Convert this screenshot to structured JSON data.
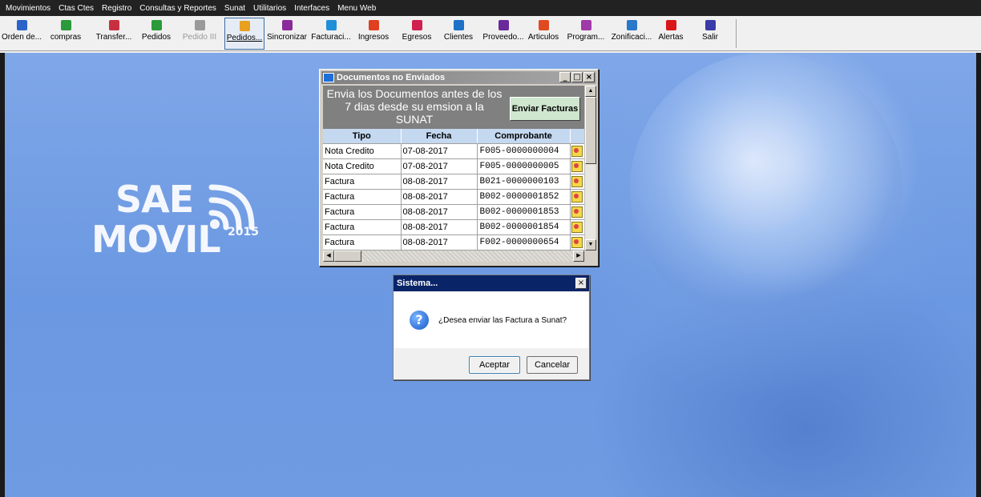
{
  "menu": [
    "Movimientos",
    "Ctas Ctes",
    "Registro",
    "Consultas y Reportes",
    "Sunat",
    "Utilitarios",
    "Interfaces",
    "Menu Web"
  ],
  "toolbar": [
    {
      "label": "Orden de...",
      "icon": "order-icon",
      "color": "#2a64c8",
      "state": "normal"
    },
    {
      "label": "compras",
      "icon": "purchases-icon",
      "color": "#2a9a3a",
      "state": "normal"
    },
    {
      "label": "Transfer...",
      "icon": "transfer-icon",
      "color": "#c83040",
      "state": "normal"
    },
    {
      "label": "Pedidos",
      "icon": "orders-icon",
      "color": "#2a9a3a",
      "state": "normal"
    },
    {
      "label": "Pedido III",
      "icon": "order-3-icon",
      "color": "#9a9a9a",
      "state": "disabled"
    },
    {
      "label": "Pedidos...",
      "icon": "orders-list-icon",
      "color": "#e8a020",
      "state": "pressed"
    },
    {
      "label": "Sincronizar",
      "icon": "sync-icon",
      "color": "#8a2a9a",
      "state": "normal"
    },
    {
      "label": "Facturaci...",
      "icon": "invoice-icon",
      "color": "#1e90d8",
      "state": "normal"
    },
    {
      "label": "Ingresos",
      "icon": "income-icon",
      "color": "#e04020",
      "state": "normal"
    },
    {
      "label": "Egresos",
      "icon": "expenses-icon",
      "color": "#d02050",
      "state": "normal"
    },
    {
      "label": "Clientes",
      "icon": "clients-icon",
      "color": "#1e70c8",
      "state": "normal"
    },
    {
      "label": "Proveedo...",
      "icon": "suppliers-icon",
      "color": "#6a2a9a",
      "state": "normal"
    },
    {
      "label": "Articulos",
      "icon": "articles-icon",
      "color": "#e04a20",
      "state": "normal"
    },
    {
      "label": "Program...",
      "icon": "program-icon",
      "color": "#a03aa8",
      "state": "normal"
    },
    {
      "label": "Zonificaci...",
      "icon": "zone-icon",
      "color": "#2a78c8",
      "state": "normal"
    },
    {
      "label": "Alertas",
      "icon": "alert-icon",
      "color": "#d81818",
      "state": "normal"
    },
    {
      "label": "Salir",
      "icon": "exit-icon",
      "color": "#3a3aa8",
      "state": "normal"
    }
  ],
  "logo": {
    "line1": "SAE",
    "line2": "MOVIL",
    "year": "2015"
  },
  "window": {
    "title": "Documentos no Enviados",
    "message": "Envia los Documentos antes de los 7 dias desde su emsion a la SUNAT",
    "send_button": "Enviar Facturas",
    "columns": [
      "Tipo",
      "Fecha",
      "Comprobante"
    ],
    "rows": [
      {
        "tipo": "Nota Credito",
        "fecha": "07-08-2017",
        "comprobante": "F005-0000000004"
      },
      {
        "tipo": "Nota Credito",
        "fecha": "07-08-2017",
        "comprobante": "F005-0000000005"
      },
      {
        "tipo": "Factura",
        "fecha": "08-08-2017",
        "comprobante": "B021-0000000103"
      },
      {
        "tipo": "Factura",
        "fecha": "08-08-2017",
        "comprobante": "B002-0000001852"
      },
      {
        "tipo": "Factura",
        "fecha": "08-08-2017",
        "comprobante": "B002-0000001853"
      },
      {
        "tipo": "Factura",
        "fecha": "08-08-2017",
        "comprobante": "B002-0000001854"
      },
      {
        "tipo": "Factura",
        "fecha": "08-08-2017",
        "comprobante": "F002-0000000654"
      }
    ]
  },
  "dialog": {
    "title": "Sistema...",
    "message": "¿Desea enviar las Factura a Sunat?",
    "ok": "Aceptar",
    "cancel": "Cancelar"
  }
}
